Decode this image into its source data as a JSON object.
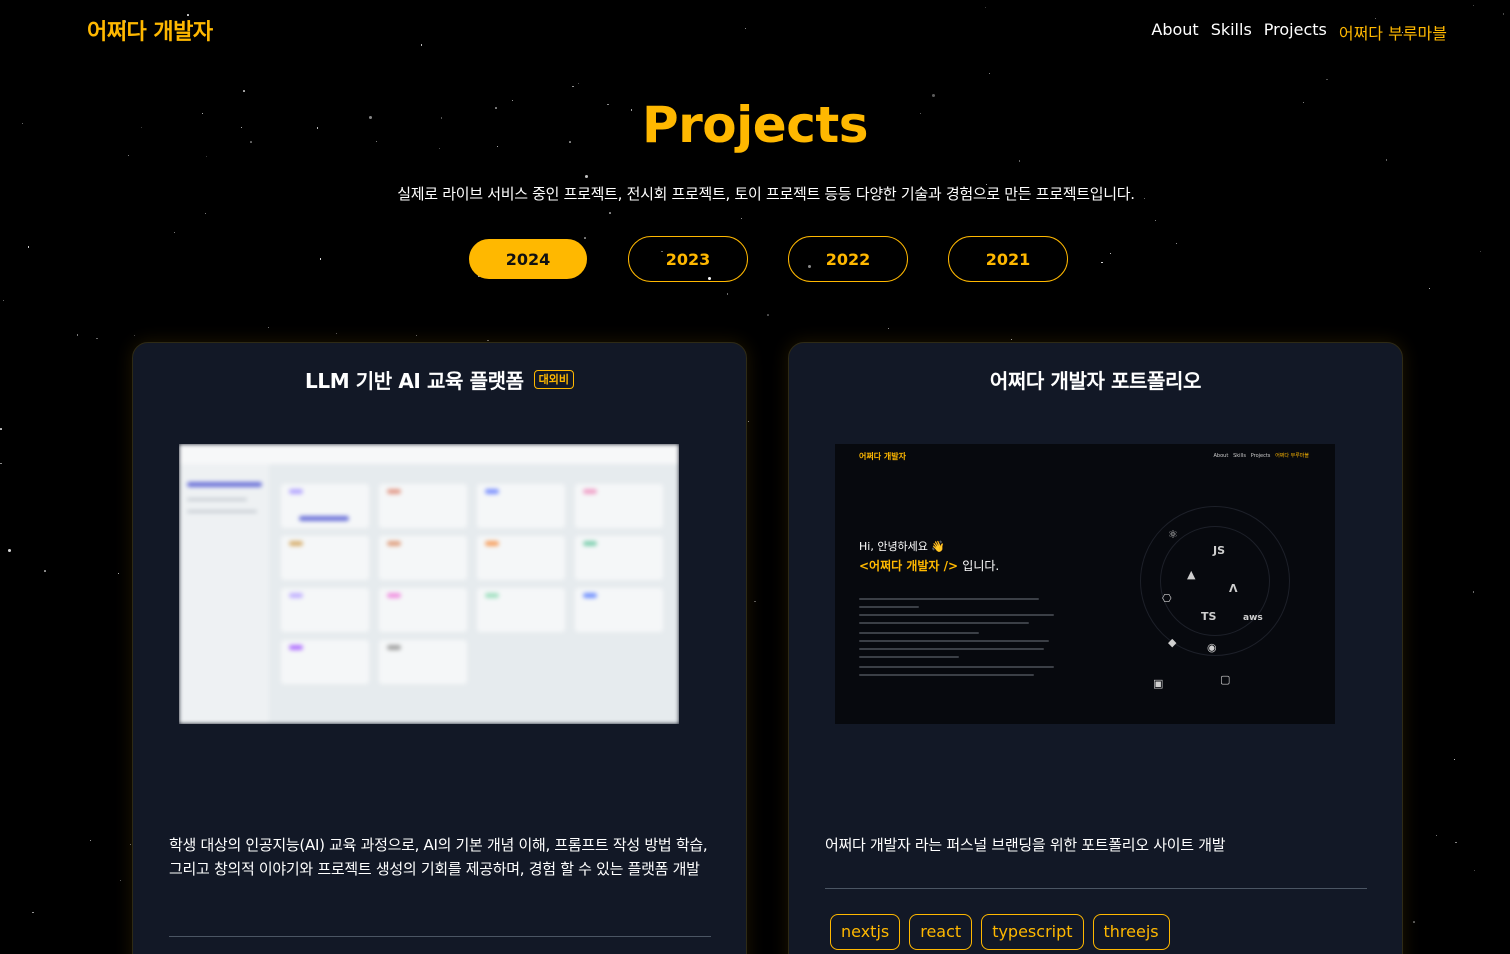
{
  "header": {
    "logo": "어쩌다 개발자",
    "nav": [
      "About",
      "Skills",
      "Projects",
      "어쩌다 부루마블"
    ]
  },
  "page": {
    "title": "Projects",
    "subtitle": "실제로 라이브 서비스 중인 프로젝트, 전시회 프로젝트, 토이 프로젝트 등등 다양한 기술과 경험으로 만든 프로젝트입니다."
  },
  "years": [
    "2024",
    "2023",
    "2022",
    "2021"
  ],
  "selected_year": "2024",
  "colors": {
    "accent": "#ffb800",
    "card_bg": "#121826",
    "page_bg": "#000000"
  },
  "projects": [
    {
      "title": "LLM 기반 AI 교육 플랫폼",
      "badge": "대외비",
      "description": "학생 대상의 인공지능(AI) 교육 과정으로, AI의 기본 개념 이해, 프롬프트 작성 방법 학습, 그리고 창의적 이야기와 프로젝트 생성의 기회를 제공하며, 경험 할 수 있는 플랫폼 개발",
      "tags": []
    },
    {
      "title": "어쩌다 개발자 포트폴리오",
      "badge": "",
      "description": "어쩌다 개발자 라는 퍼스널 브랜딩을 위한 포트폴리오 사이트 개발",
      "tags": [
        "nextjs",
        "react",
        "typescript",
        "threejs"
      ],
      "preview": {
        "logo": "어쩌다 개발자",
        "nav": [
          "About",
          "Skills",
          "Projects",
          "어쩌다 부루마블"
        ],
        "greeting": "Hi, 안녕하세요 👋",
        "name": "<어쩌다 개발자 />",
        "name_suffix": "입니다.",
        "icons": [
          "JS",
          "TS",
          "aws"
        ]
      }
    }
  ]
}
